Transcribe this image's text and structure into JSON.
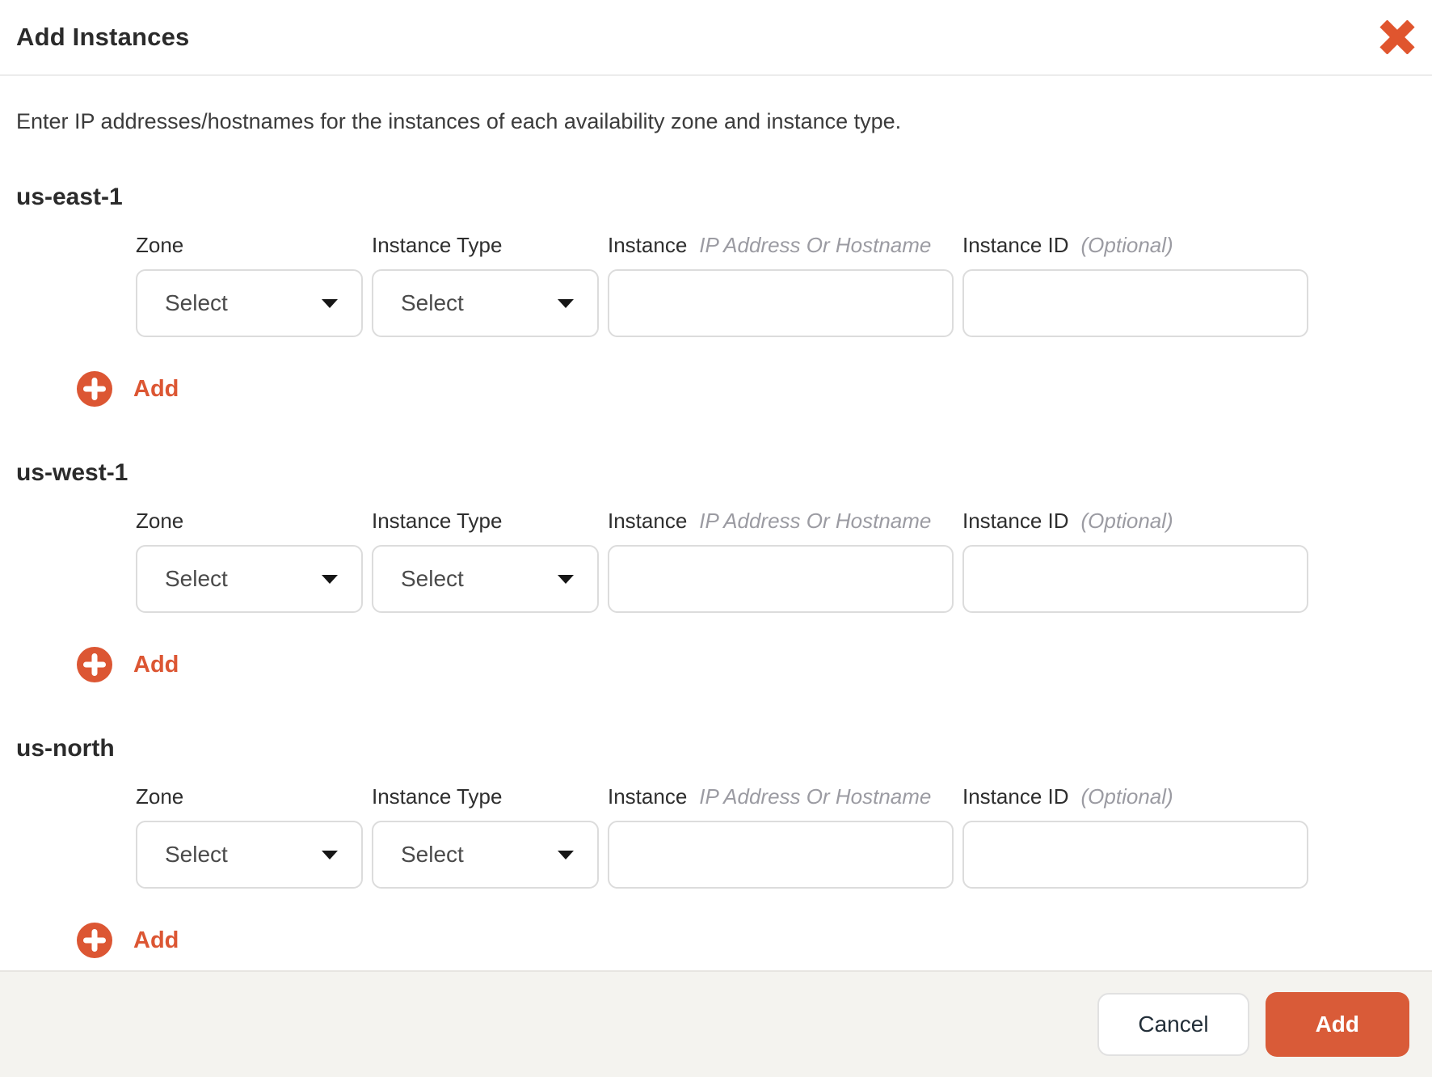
{
  "modal": {
    "title": "Add Instances",
    "description": "Enter IP addresses/hostnames for the instances of each availability zone and instance type."
  },
  "field_labels": {
    "zone": "Zone",
    "instance_type": "Instance Type",
    "instance": "Instance",
    "instance_hint": "IP Address Or Hostname",
    "instance_id": "Instance ID",
    "instance_id_hint": "(Optional)"
  },
  "controls": {
    "select_placeholder": "Select",
    "instance_value": "",
    "instance_id_value": ""
  },
  "sections": [
    {
      "name": "us-east-1",
      "add_row_label": "Add"
    },
    {
      "name": "us-west-1",
      "add_row_label": "Add"
    },
    {
      "name": "us-north",
      "add_row_label": "Add"
    }
  ],
  "footer": {
    "cancel_label": "Cancel",
    "submit_label": "Add"
  },
  "icons": {
    "close": "close-x",
    "add": "plus-in-circle",
    "select_caret": "triangle-down"
  },
  "colors": {
    "accent_orange": "#DC5633",
    "submit_button_bg": "#D95B38",
    "footer_bg": "#F4F3EF",
    "field_border": "#DCDCDC",
    "text_dark": "#2B2B2B",
    "hint_gray": "#9B9BA2"
  }
}
